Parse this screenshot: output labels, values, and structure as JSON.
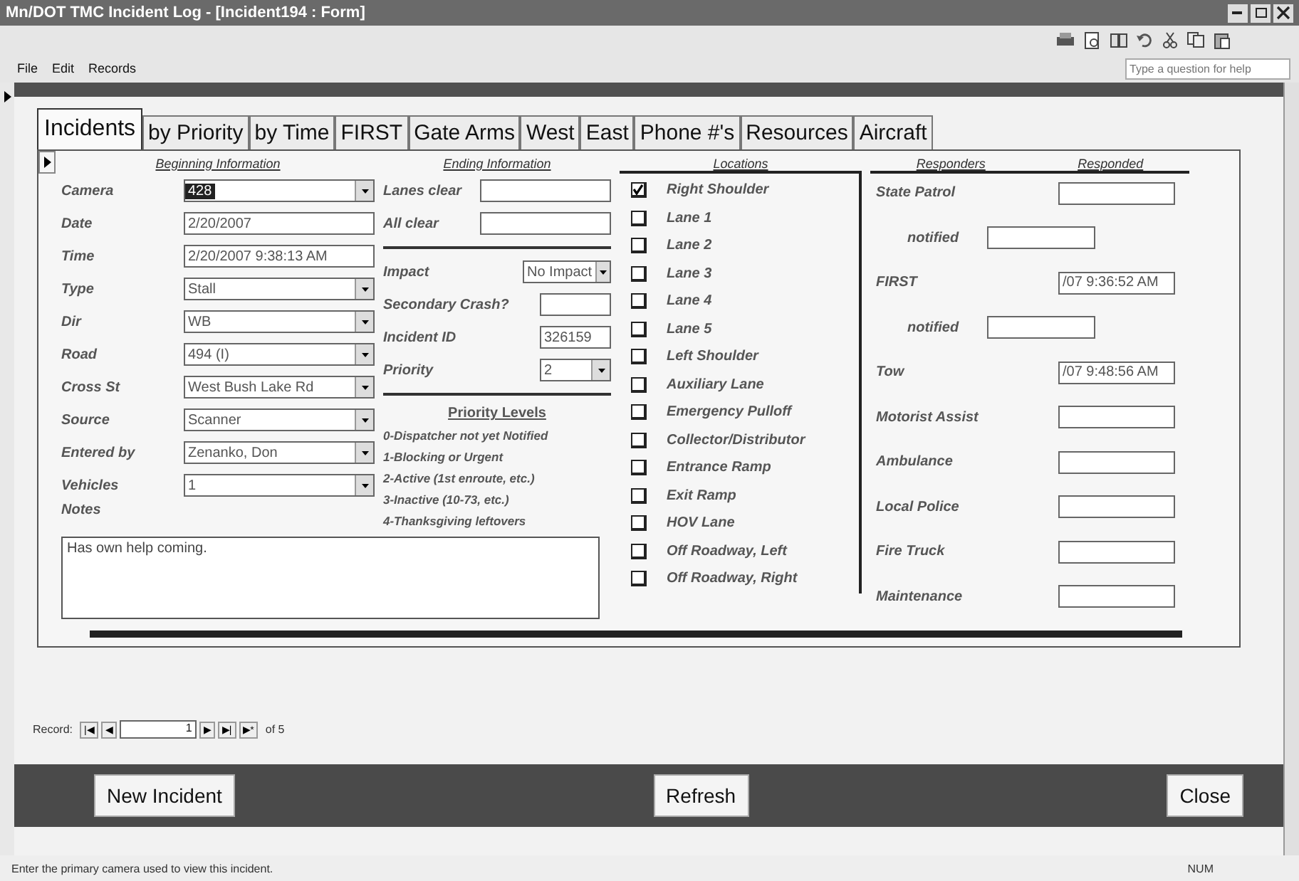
{
  "window": {
    "title": "Mn/DOT TMC Incident Log - [Incident194 : Form]"
  },
  "menu": [
    "File",
    "Edit",
    "Records"
  ],
  "help_box": {
    "placeholder": "Type a question for help"
  },
  "tabs": [
    {
      "label": "Incidents",
      "selected": true
    },
    {
      "label": "by Priority",
      "selected": false
    },
    {
      "label": "by Time",
      "selected": false
    },
    {
      "label": "FIRST",
      "selected": false
    },
    {
      "label": "Gate Arms",
      "selected": false
    },
    {
      "label": "West",
      "selected": false
    },
    {
      "label": "East",
      "selected": false
    },
    {
      "label": "Phone #'s",
      "selected": false
    },
    {
      "label": "Resources",
      "selected": false
    },
    {
      "label": "Aircraft",
      "selected": false
    }
  ],
  "beginning": {
    "heading": "Beginning Information",
    "fields": [
      {
        "label": "Camera",
        "value": "428",
        "kind": "combo",
        "highlighted": true
      },
      {
        "label": "Date",
        "value": "2/20/2007",
        "kind": "text",
        "highlighted": false
      },
      {
        "label": "Time",
        "value": "2/20/2007 9:38:13 AM",
        "kind": "text",
        "highlighted": false
      },
      {
        "label": "Type",
        "value": "Stall",
        "kind": "combo",
        "highlighted": false
      },
      {
        "label": "Dir",
        "value": "WB",
        "kind": "combo",
        "highlighted": false
      },
      {
        "label": "Road",
        "value": "494 (I)",
        "kind": "combo",
        "highlighted": false
      },
      {
        "label": "Cross St",
        "value": "West Bush Lake Rd",
        "kind": "combo",
        "highlighted": false
      },
      {
        "label": "Source",
        "value": "Scanner",
        "kind": "combo",
        "highlighted": false
      },
      {
        "label": "Entered by",
        "value": "Zenanko, Don",
        "kind": "combo",
        "highlighted": false
      },
      {
        "label": "Vehicles",
        "value": "1",
        "kind": "combo",
        "highlighted": false
      }
    ],
    "notes_label": "Notes",
    "notes": "Has own help coming."
  },
  "ending": {
    "heading": "Ending Information",
    "clear_fields": [
      {
        "label": "Lanes clear"
      },
      {
        "label": "All clear"
      }
    ],
    "fields": [
      {
        "label": "Impact",
        "value": "No Impact",
        "kind": "combo"
      },
      {
        "label": "Secondary Crash?",
        "kind": "text"
      },
      {
        "label": "Incident ID",
        "value": "326159",
        "kind": "text"
      },
      {
        "label": "Priority",
        "value": "2",
        "kind": "combo"
      }
    ],
    "priority_heading": "Priority Levels",
    "priority_levels": [
      "0-Dispatcher not yet Notified",
      "1-Blocking or Urgent",
      "2-Active (1st enroute, etc.)",
      "3-Inactive (10-73, etc.)",
      "4-Thanksgiving leftovers"
    ]
  },
  "locations": {
    "heading": "Locations",
    "items": [
      {
        "label": "Right Shoulder",
        "checked": true
      },
      {
        "label": "Lane 1",
        "checked": false
      },
      {
        "label": "Lane 2",
        "checked": false
      },
      {
        "label": "Lane 3",
        "checked": false
      },
      {
        "label": "Lane 4",
        "checked": false
      },
      {
        "label": "Lane 5",
        "checked": false
      },
      {
        "label": "Left Shoulder",
        "checked": false
      },
      {
        "label": "Auxiliary Lane",
        "checked": false
      },
      {
        "label": "Emergency Pulloff",
        "checked": false
      },
      {
        "label": "Collector/Distributor",
        "checked": false
      },
      {
        "label": "Entrance Ramp",
        "checked": false
      },
      {
        "label": "Exit Ramp",
        "checked": false
      },
      {
        "label": "HOV Lane",
        "checked": false
      },
      {
        "label": "Off Roadway, Left",
        "checked": false
      },
      {
        "label": "Off Roadway, Right",
        "checked": false
      }
    ]
  },
  "responders": {
    "heading": "Responders",
    "heading_2": "Responded",
    "items": [
      {
        "label": "State Patrol",
        "kind": "responder"
      },
      {
        "label": "notified",
        "kind": "notified"
      },
      {
        "label": "FIRST",
        "value": "/07 9:36:52 AM",
        "kind": "responder"
      },
      {
        "label": "notified",
        "kind": "notified"
      },
      {
        "label": "Tow",
        "value": "/07 9:48:56 AM",
        "kind": "responder"
      },
      {
        "label": "Motorist Assist",
        "kind": "responder"
      },
      {
        "label": "Ambulance",
        "kind": "responder"
      },
      {
        "label": "Local Police",
        "kind": "responder"
      },
      {
        "label": "Fire Truck",
        "kind": "responder"
      },
      {
        "label": "Maintenance",
        "kind": "responder"
      }
    ]
  },
  "record_nav": {
    "label": "Record:",
    "first": "|◀",
    "prev": "◀",
    "current": "1",
    "next": "▶",
    "last": "▶|",
    "new": "▶*",
    "total": "of 5"
  },
  "buttons": [
    "New Incident",
    "Refresh",
    "Close"
  ],
  "status_bar": {
    "text": "Enter the primary camera used to view this incident.",
    "indicator": "NUM"
  }
}
